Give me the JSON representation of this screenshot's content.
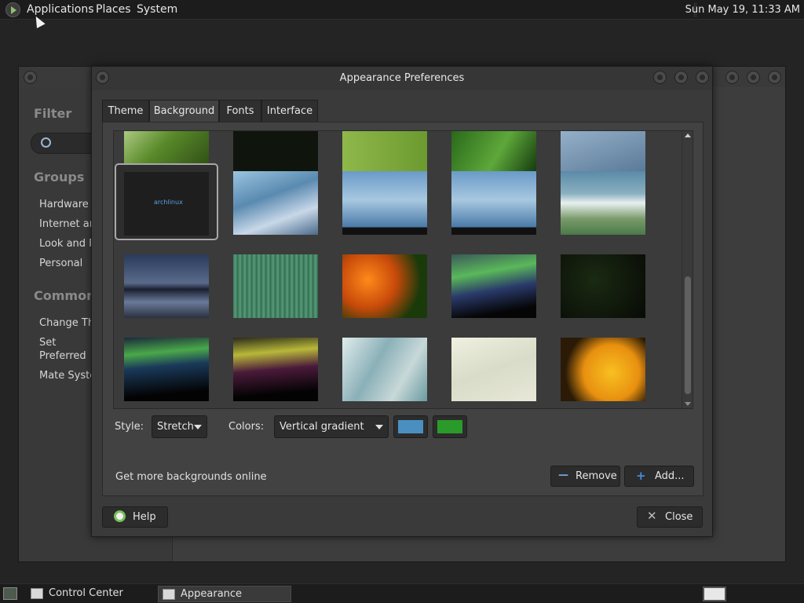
{
  "top_panel": {
    "menus": [
      "Applications",
      "Places",
      "System"
    ],
    "clock": "Sun May 19, 11:33 AM"
  },
  "control_center": {
    "filter_label": "Filter",
    "groups_label": "Groups",
    "groups": [
      "Hardware",
      "Internet and Network",
      "Look and Feel",
      "Personal"
    ],
    "common_tasks_label": "Common Tasks",
    "common_tasks": [
      "Change Theme",
      "Set Preferred Applications",
      "Mate System Monitor"
    ]
  },
  "dialog": {
    "title": "Appearance Preferences",
    "tabs": [
      "Theme",
      "Background",
      "Fonts",
      "Interface"
    ],
    "active_tab": "Background",
    "selected_background_text": "archlinux",
    "style_label": "Style:",
    "style_value": "Stretch",
    "colors_label": "Colors:",
    "colors_value": "Vertical gradient",
    "color_primary": "#4a8fc0",
    "color_secondary": "#2a9a2a",
    "more_backgrounds": "Get more backgrounds online",
    "remove_label": "Remove",
    "add_label": "Add...",
    "help_label": "Help",
    "close_label": "Close"
  },
  "taskbar": {
    "tasks": [
      "Control Center",
      "Appearance Prefere..."
    ]
  }
}
